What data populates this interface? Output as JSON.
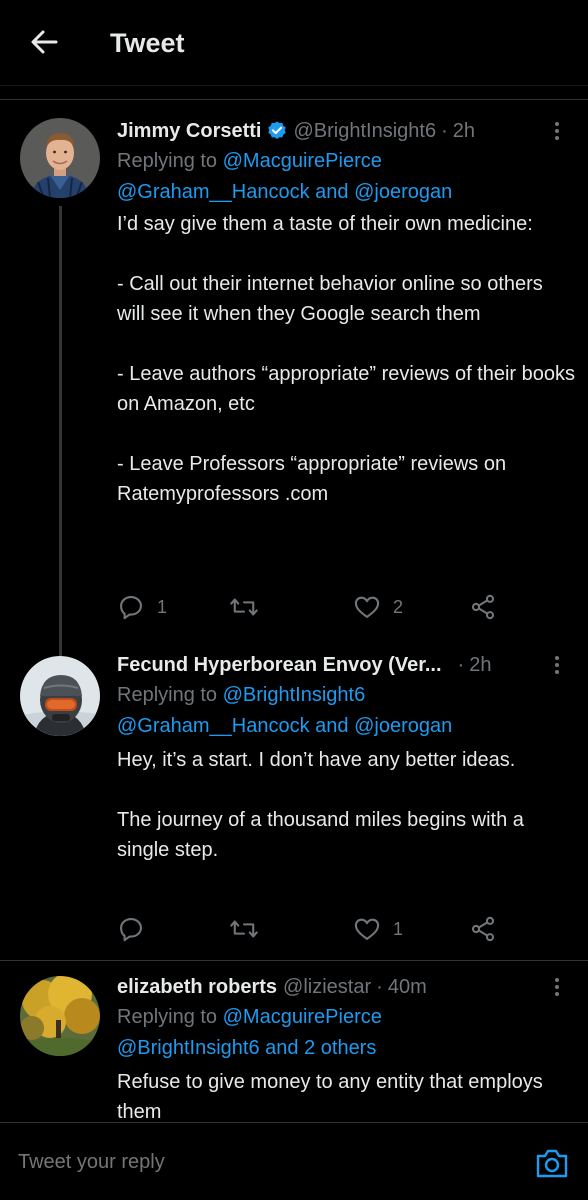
{
  "header": {
    "title": "Tweet",
    "back_icon": "arrow-left-icon"
  },
  "tweets": [
    {
      "name": "Jimmy Corsetti",
      "verified": true,
      "handle": "@BrightInsight6",
      "time": "2h",
      "reply_prefix": "Replying to",
      "reply_line1": "@MacguirePierce",
      "reply_line2": "@Graham__Hancock and @joerogan",
      "text": "I’d say give them a taste of their own medicine:\n\n- Call out their internet behavior online so others will see it when they Google search them\n\n- Leave authors “appropriate” reviews of their books on Amazon, etc\n\n- Leave Professors “appropriate” reviews on Ratemyprofessors .com",
      "replies": "1",
      "retweets": "",
      "likes": "2"
    },
    {
      "name": "Fecund Hyperborean Envoy (Ver...",
      "verified": false,
      "handle": "",
      "time": "2h",
      "reply_prefix": "Replying to",
      "reply_line1": "@BrightInsight6",
      "reply_line2": "@Graham__Hancock and @joerogan",
      "text": "Hey, it’s a start. I don’t have any better ideas.\n\nThe journey of a thousand miles begins with a single step.",
      "replies": "",
      "retweets": "",
      "likes": "1"
    },
    {
      "name": "elizabeth roberts",
      "verified": false,
      "handle": "@liziestar",
      "time": "40m",
      "reply_prefix": "Replying to",
      "reply_line1": "@MacguirePierce",
      "reply_line2": "@BrightInsight6 and 2 others",
      "text": "Refuse to give money to any entity that employs them"
    }
  ],
  "composer": {
    "placeholder": "Tweet your reply",
    "camera_icon": "camera-icon"
  },
  "colors": {
    "background": "#000000",
    "text": "#e7e9ea",
    "secondary": "#71767b",
    "accent": "#1d9bf0",
    "divider": "#2f3336"
  }
}
